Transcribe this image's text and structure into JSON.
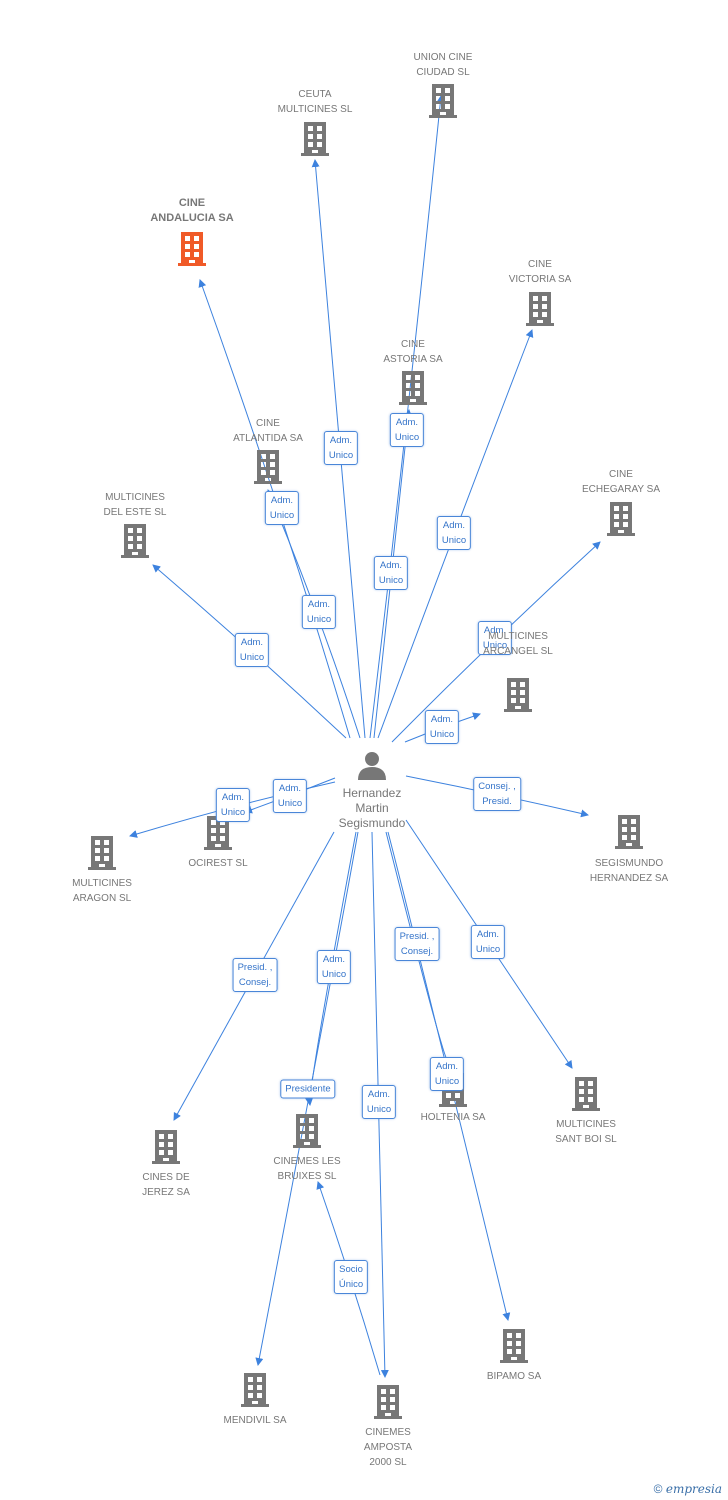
{
  "center": {
    "id": "hms",
    "name": [
      "Hernandez",
      "Martin",
      "Segismundo"
    ],
    "icon": "person-icon"
  },
  "colors": {
    "edge": "#3d82de",
    "building": "#777777",
    "highlight": "#f05a28"
  },
  "nodes": [
    {
      "id": "andalucia",
      "label": [
        "CINE",
        "ANDALUCIA SA"
      ],
      "highlight": true
    },
    {
      "id": "ceuta",
      "label": [
        "CEUTA",
        "MULTICINES SL"
      ]
    },
    {
      "id": "union",
      "label": [
        "UNION CINE",
        "CIUDAD SL"
      ]
    },
    {
      "id": "victoria",
      "label": [
        "CINE",
        "VICTORIA SA"
      ]
    },
    {
      "id": "astoria",
      "label": [
        "CINE",
        "ASTORIA SA"
      ]
    },
    {
      "id": "atlantida",
      "label": [
        "CINE",
        "ATLANTIDA SA"
      ]
    },
    {
      "id": "deleste",
      "label": [
        "MULTICINES",
        "DEL ESTE SL"
      ]
    },
    {
      "id": "echegaray",
      "label": [
        "CINE",
        "ECHEGARAY SA"
      ]
    },
    {
      "id": "arcangel",
      "label": [
        "MULTICINES",
        "ARCANGEL SL"
      ]
    },
    {
      "id": "ocirest",
      "label": [
        "OCIREST SL"
      ]
    },
    {
      "id": "aragon",
      "label": [
        "MULTICINES",
        "ARAGON SL"
      ]
    },
    {
      "id": "segismundo",
      "label": [
        "SEGISMUNDO",
        "HERNANDEZ SA"
      ]
    },
    {
      "id": "jerez",
      "label": [
        "CINES DE",
        "JEREZ SA"
      ]
    },
    {
      "id": "bruixes",
      "label": [
        "CINEMES LES",
        "BRUIXES SL"
      ]
    },
    {
      "id": "holtenia",
      "label": [
        "HOLTENIA SA"
      ]
    },
    {
      "id": "santboi",
      "label": [
        "MULTICINES",
        "SANT BOI SL"
      ]
    },
    {
      "id": "mendivil",
      "label": [
        "MENDIVIL SA"
      ]
    },
    {
      "id": "amposta",
      "label": [
        "CINEMES",
        "AMPOSTA",
        "2000 SL"
      ]
    },
    {
      "id": "bipamo",
      "label": [
        "BIPAMO SA"
      ]
    }
  ],
  "edges": [
    {
      "from": "hms",
      "to": "andalucia",
      "label": [
        "Adm.",
        "Unico"
      ]
    },
    {
      "from": "hms",
      "to": "ceuta",
      "label": [
        "Adm.",
        "Unico"
      ]
    },
    {
      "from": "hms",
      "to": "union",
      "label": [
        "Adm.",
        "Unico"
      ]
    },
    {
      "from": "hms",
      "to": "victoria",
      "label": [
        "Adm.",
        "Unico"
      ]
    },
    {
      "from": "hms",
      "to": "astoria",
      "label": [
        "Adm.",
        "Unico"
      ]
    },
    {
      "from": "hms",
      "to": "atlantida",
      "label": [
        "Adm.",
        "Unico"
      ]
    },
    {
      "from": "hms",
      "to": "deleste",
      "label": [
        "Adm.",
        "Unico"
      ]
    },
    {
      "from": "hms",
      "to": "echegaray",
      "label": [
        "Adm.",
        "Unico"
      ]
    },
    {
      "from": "hms",
      "to": "arcangel",
      "label": [
        "Adm.",
        "Unico"
      ]
    },
    {
      "from": "hms",
      "to": "ocirest",
      "label": [
        "Adm.",
        "Unico"
      ]
    },
    {
      "from": "hms",
      "to": "aragon",
      "label": [
        "Adm.",
        "Unico"
      ]
    },
    {
      "from": "hms",
      "to": "segismundo",
      "label": [
        "Consej. ,",
        "Presid."
      ]
    },
    {
      "from": "hms",
      "to": "jerez",
      "label": [
        "Presid. ,",
        "Consej."
      ]
    },
    {
      "from": "hms",
      "to": "bruixes",
      "label": [
        "Presidente"
      ]
    },
    {
      "from": "hms",
      "to": "mendivil",
      "label": [
        "Adm.",
        "Unico"
      ]
    },
    {
      "from": "hms",
      "to": "holtenia",
      "label": [
        "Adm.",
        "Unico"
      ]
    },
    {
      "from": "hms",
      "to": "bipamo",
      "label": [
        "Presid. ,",
        "Consej."
      ]
    },
    {
      "from": "hms",
      "to": "santboi",
      "label": [
        "Adm.",
        "Unico"
      ]
    },
    {
      "from": "hms",
      "to": "amposta",
      "label": [
        "Adm.",
        "Unico"
      ]
    },
    {
      "from": "amposta",
      "to": "bruixes",
      "label": [
        "Socio",
        "Único"
      ]
    }
  ],
  "footer": {
    "copyright": "©",
    "brand": "empresia"
  }
}
